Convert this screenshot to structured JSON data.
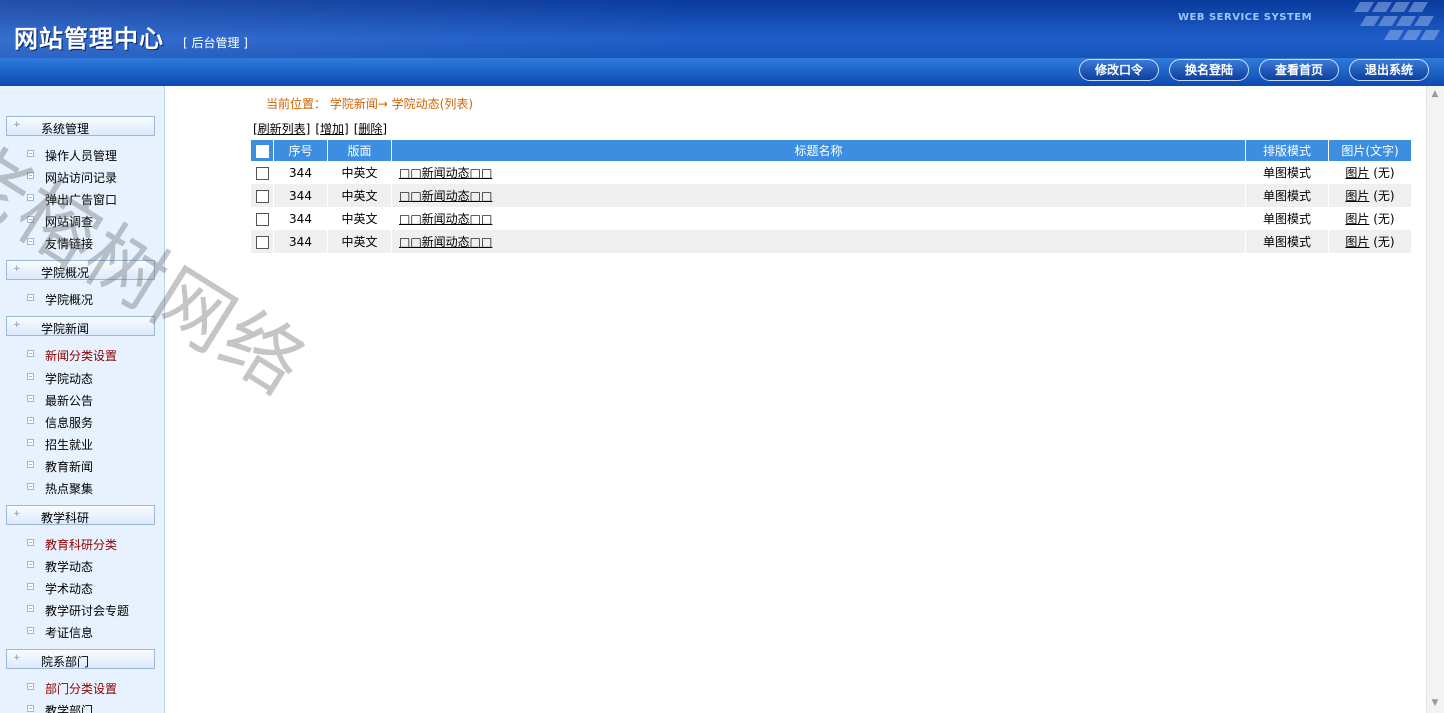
{
  "header": {
    "title": "网站管理中心",
    "subtitle": "[ 后台管理 ]",
    "tagline": "WEB SERVICE SYSTEM",
    "buttons": [
      "修改口令",
      "换名登陆",
      "查看首页",
      "退出系统"
    ]
  },
  "sidebar": {
    "groups": [
      {
        "label": "系统管理",
        "items": [
          "操作人员管理",
          "网站访问记录",
          "弹出广告窗口",
          "网站调查",
          "友情链接"
        ]
      },
      {
        "label": "学院概况",
        "items": [
          "学院概况"
        ]
      },
      {
        "label": "学院新闻",
        "items": [
          "新闻分类设置",
          "学院动态",
          "最新公告",
          "信息服务",
          "招生就业",
          "教育新闻",
          "热点聚集"
        ]
      },
      {
        "label": "教学科研",
        "items": [
          "教育科研分类",
          "教学动态",
          "学术动态",
          "教学研讨会专题",
          "考证信息"
        ]
      },
      {
        "label": "院系部门",
        "items": [
          "部门分类设置",
          "教学部门"
        ]
      }
    ]
  },
  "main": {
    "breadcrumb": "当前位置： 学院新闻→ 学院动态(列表)",
    "actions": [
      "[刷新列表]",
      "[增加]",
      "[删除]"
    ],
    "columns": [
      "序号",
      "版面",
      "标题名称",
      "排版模式",
      "图片(文字)"
    ],
    "rows": [
      {
        "num": "344",
        "version": "中英文",
        "title": "□□新闻动态□□",
        "mode": "单图模式",
        "pic": "图片",
        "pic_note": "(无)"
      },
      {
        "num": "344",
        "version": "中英文",
        "title": "□□新闻动态□□",
        "mode": "单图模式",
        "pic": "图片",
        "pic_note": "(无)"
      },
      {
        "num": "344",
        "version": "中英文",
        "title": "□□新闻动态□□",
        "mode": "单图模式",
        "pic": "图片",
        "pic_note": "(无)"
      },
      {
        "num": "344",
        "version": "中英文",
        "title": "□□新闻动态□□",
        "mode": "单图模式",
        "pic": "图片",
        "pic_note": "(无)"
      }
    ]
  },
  "watermark": "老榕树网络",
  "colors": {
    "header": "#0a3a9c",
    "table_header": "#3d8ee0",
    "breadcrumb": "#d06400",
    "sidebar_bg": "#e8f2fe"
  }
}
